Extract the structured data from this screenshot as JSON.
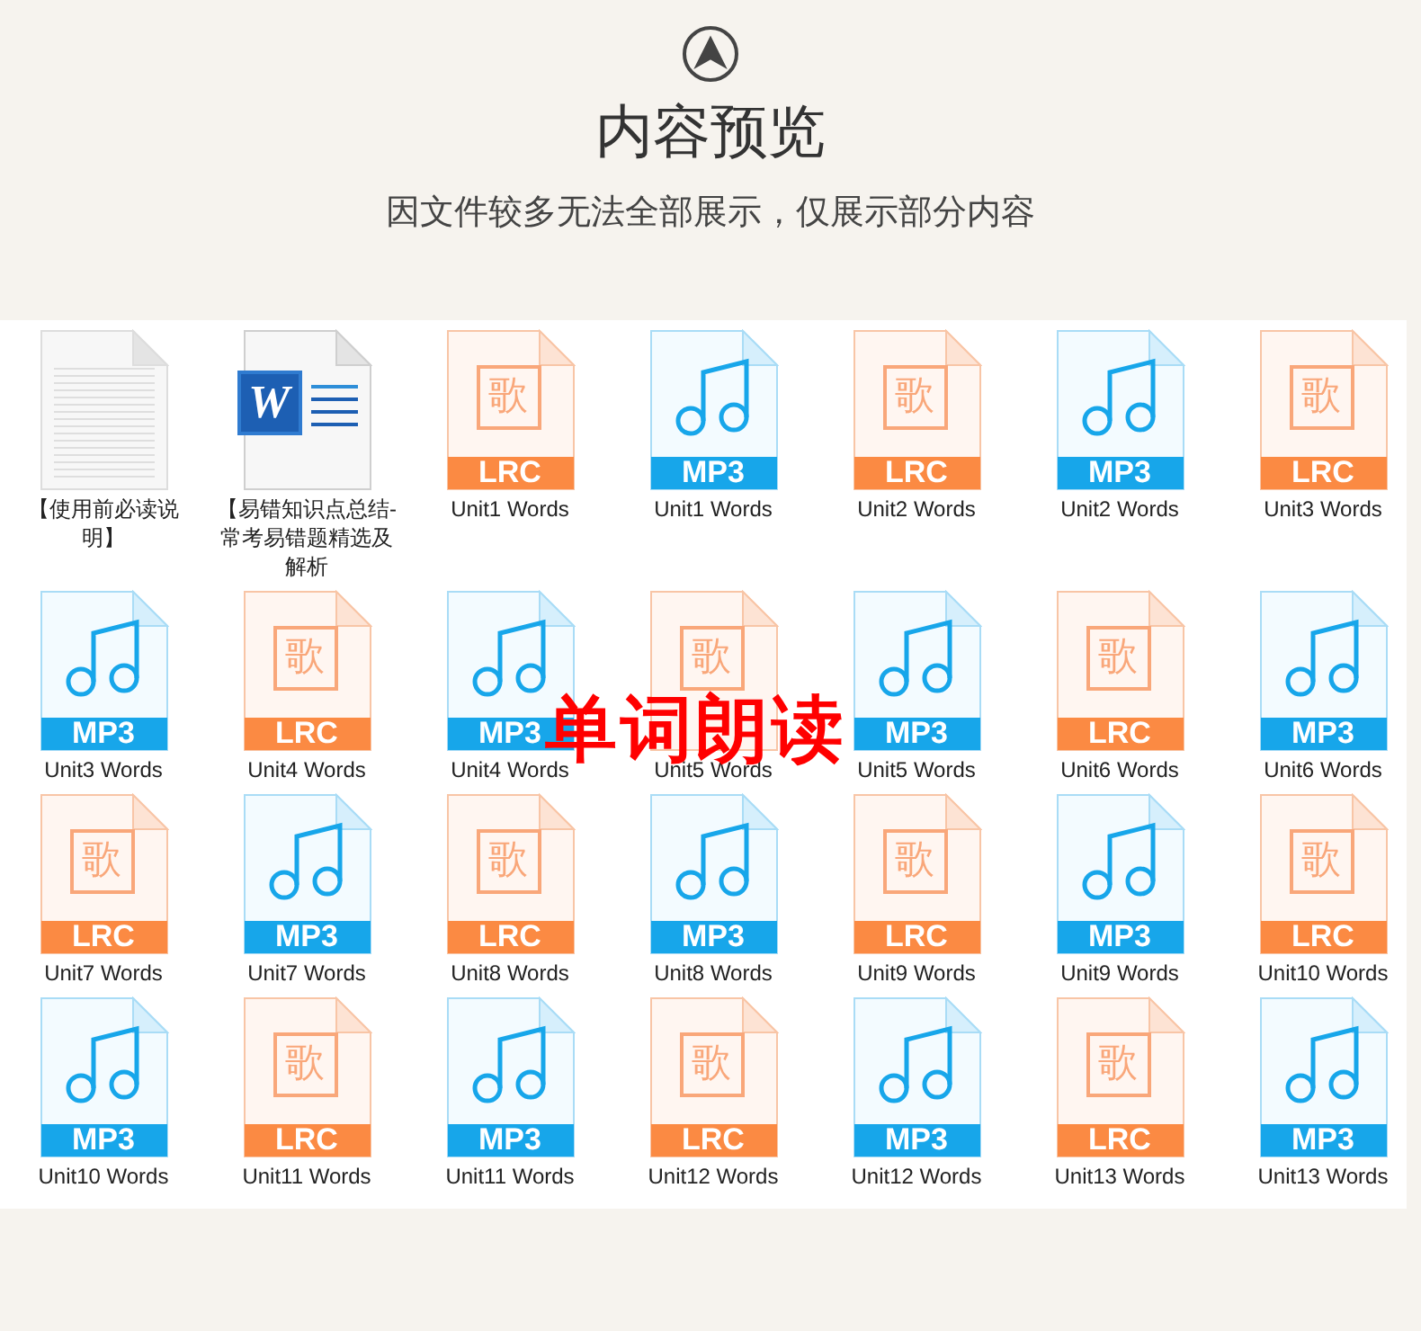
{
  "header": {
    "title": "内容预览",
    "subtitle": "因文件较多无法全部展示，仅展示部分内容"
  },
  "files": [
    {
      "kind": "text",
      "name": "【使用前必读说明】"
    },
    {
      "kind": "word",
      "glyph": "W",
      "name": "【易错知识点总结-常考易错题精选及解析"
    },
    {
      "kind": "lrc",
      "glyph": "歌",
      "badge": "LRC",
      "name": "Unit1 Words"
    },
    {
      "kind": "mp3",
      "badge": "MP3",
      "name": "Unit1 Words"
    },
    {
      "kind": "lrc",
      "glyph": "歌",
      "badge": "LRC",
      "name": "Unit2 Words"
    },
    {
      "kind": "mp3",
      "badge": "MP3",
      "name": "Unit2 Words"
    },
    {
      "kind": "lrc",
      "glyph": "歌",
      "badge": "LRC",
      "name": "Unit3 Words"
    },
    {
      "kind": "mp3",
      "badge": "MP3",
      "name": "Unit3 Words"
    },
    {
      "kind": "lrc",
      "glyph": "歌",
      "badge": "LRC",
      "name": "Unit4 Words"
    },
    {
      "kind": "mp3",
      "badge": "MP3",
      "name": "Unit4 Words"
    },
    {
      "kind": "lrc",
      "glyph": "歌",
      "name": "Unit5 Words"
    },
    {
      "kind": "mp3",
      "badge": "MP3",
      "name": "Unit5 Words"
    },
    {
      "kind": "lrc",
      "glyph": "歌",
      "badge": "LRC",
      "name": "Unit6 Words"
    },
    {
      "kind": "mp3",
      "badge": "MP3",
      "name": "Unit6 Words"
    },
    {
      "kind": "lrc",
      "glyph": "歌",
      "badge": "LRC",
      "name": "Unit7 Words"
    },
    {
      "kind": "mp3",
      "badge": "MP3",
      "name": "Unit7 Words"
    },
    {
      "kind": "lrc",
      "glyph": "歌",
      "badge": "LRC",
      "name": "Unit8 Words"
    },
    {
      "kind": "mp3",
      "badge": "MP3",
      "name": "Unit8 Words"
    },
    {
      "kind": "lrc",
      "glyph": "歌",
      "badge": "LRC",
      "name": "Unit9 Words"
    },
    {
      "kind": "mp3",
      "badge": "MP3",
      "name": "Unit9 Words"
    },
    {
      "kind": "lrc",
      "glyph": "歌",
      "badge": "LRC",
      "name": "Unit10 Words"
    },
    {
      "kind": "mp3",
      "badge": "MP3",
      "name": "Unit10 Words"
    },
    {
      "kind": "lrc",
      "glyph": "歌",
      "badge": "LRC",
      "name": "Unit11 Words"
    },
    {
      "kind": "mp3",
      "badge": "MP3",
      "name": "Unit11 Words"
    },
    {
      "kind": "lrc",
      "glyph": "歌",
      "badge": "LRC",
      "name": "Unit12 Words"
    },
    {
      "kind": "mp3",
      "badge": "MP3",
      "name": "Unit12 Words"
    },
    {
      "kind": "lrc",
      "glyph": "歌",
      "badge": "LRC",
      "name": "Unit13 Words"
    },
    {
      "kind": "mp3",
      "badge": "MP3",
      "name": "Unit13 Words"
    }
  ],
  "overlay": "单词朗读"
}
